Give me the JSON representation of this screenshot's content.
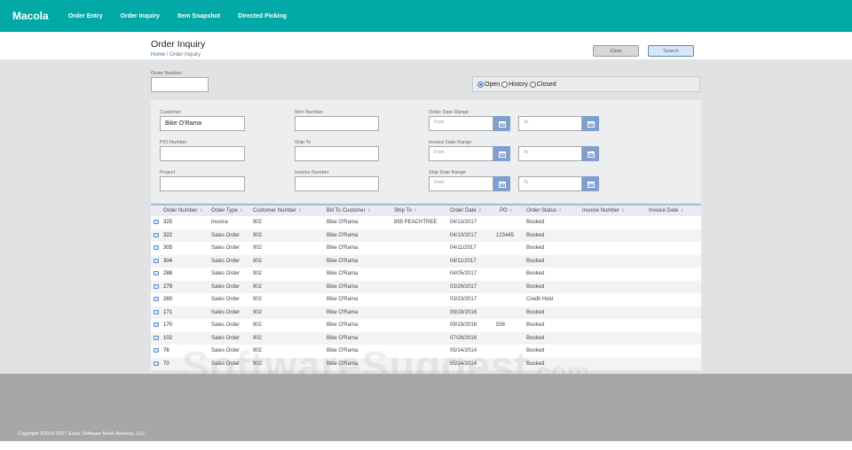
{
  "nav": {
    "brand": "Macola",
    "items": [
      "Order Entry",
      "Order Inquiry",
      "Item Snapshot",
      "Directed Picking"
    ]
  },
  "header": {
    "title": "Order Inquiry",
    "breadcrumb_home": "Home",
    "breadcrumb_sep": " / ",
    "breadcrumb_current": "Order Inquiry",
    "clear_label": "Clear",
    "search_label": "Search"
  },
  "order_number": {
    "label": "Order Number",
    "value": ""
  },
  "status": {
    "options": [
      "Open",
      "History",
      "Closed"
    ],
    "selected": "Open"
  },
  "filters": {
    "customer": {
      "label": "Customer",
      "value": "Bike O'Rama"
    },
    "po_number": {
      "label": "P/O Number",
      "value": ""
    },
    "project": {
      "label": "Project",
      "value": ""
    },
    "item_number": {
      "label": "Item Number",
      "value": ""
    },
    "ship_to": {
      "label": "Ship To",
      "value": ""
    },
    "invoice_number": {
      "label": "Invoice Number",
      "value": ""
    },
    "order_date_range": {
      "label": "Order Date Range"
    },
    "invoice_date_range": {
      "label": "Invoice Date Range"
    },
    "ship_date_range": {
      "label": "Ship Date Range"
    },
    "from_placeholder": "From",
    "to_placeholder": "To"
  },
  "table": {
    "columns": [
      "Order Number",
      "Order Type",
      "Customer Number",
      "Bill To Customer",
      "Ship To",
      "Order Date",
      "PO",
      "Order Status",
      "Invoice Number",
      "Invoice Date"
    ],
    "sort_icon": "⇕",
    "rows": [
      [
        "325",
        "Invoice",
        "902",
        "Bike O'Rama",
        "899 PEACHTREE",
        "04/13/2017",
        "",
        "Booked",
        "",
        ""
      ],
      [
        "322",
        "Sales Order",
        "902",
        "Bike O'Rama",
        "",
        "04/13/2017",
        "123445",
        "Booked",
        "",
        ""
      ],
      [
        "305",
        "Sales Order",
        "902",
        "Bike O'Rama",
        "",
        "04/11/2017",
        "",
        "Booked",
        "",
        ""
      ],
      [
        "304",
        "Sales Order",
        "902",
        "Bike O'Rama",
        "",
        "04/11/2017",
        "",
        "Booked",
        "",
        ""
      ],
      [
        "288",
        "Sales Order",
        "902",
        "Bike O'Rama",
        "",
        "04/05/2017",
        "",
        "Booked",
        "",
        ""
      ],
      [
        "279",
        "Sales Order",
        "902",
        "Bike O'Rama",
        "",
        "03/29/2017",
        "",
        "Booked",
        "",
        ""
      ],
      [
        "260",
        "Sales Order",
        "902",
        "Bike O'Rama",
        "",
        "03/23/2017",
        "",
        "Credit Hold",
        "",
        ""
      ],
      [
        "171",
        "Sales Order",
        "902",
        "Bike O'Rama",
        "",
        "09/19/2016",
        "",
        "Booked",
        "",
        ""
      ],
      [
        "170",
        "Sales Order",
        "902",
        "Bike O'Rama",
        "",
        "09/19/2016",
        "556",
        "Booked",
        "",
        ""
      ],
      [
        "102",
        "Sales Order",
        "902",
        "Bike O'Rama",
        "",
        "07/28/2016",
        "",
        "Booked",
        "",
        ""
      ],
      [
        "76",
        "Sales Order",
        "902",
        "Bike O'Rama",
        "",
        "05/14/2014",
        "",
        "Booked",
        "",
        ""
      ],
      [
        "70",
        "Sales Order",
        "902",
        "Bike O'Rama",
        "",
        "05/14/2014",
        "",
        "Booked",
        "",
        ""
      ]
    ]
  },
  "footer": {
    "copyright": "Copyright ©2016-2017 Exact Software North America, LLC"
  },
  "watermark": {
    "text": "SoftwareSuggest",
    "domain": ".com"
  },
  "colors": {
    "nav": "#00a9a6",
    "accent": "#3a77b8",
    "calendar": "#7f9fcc"
  }
}
